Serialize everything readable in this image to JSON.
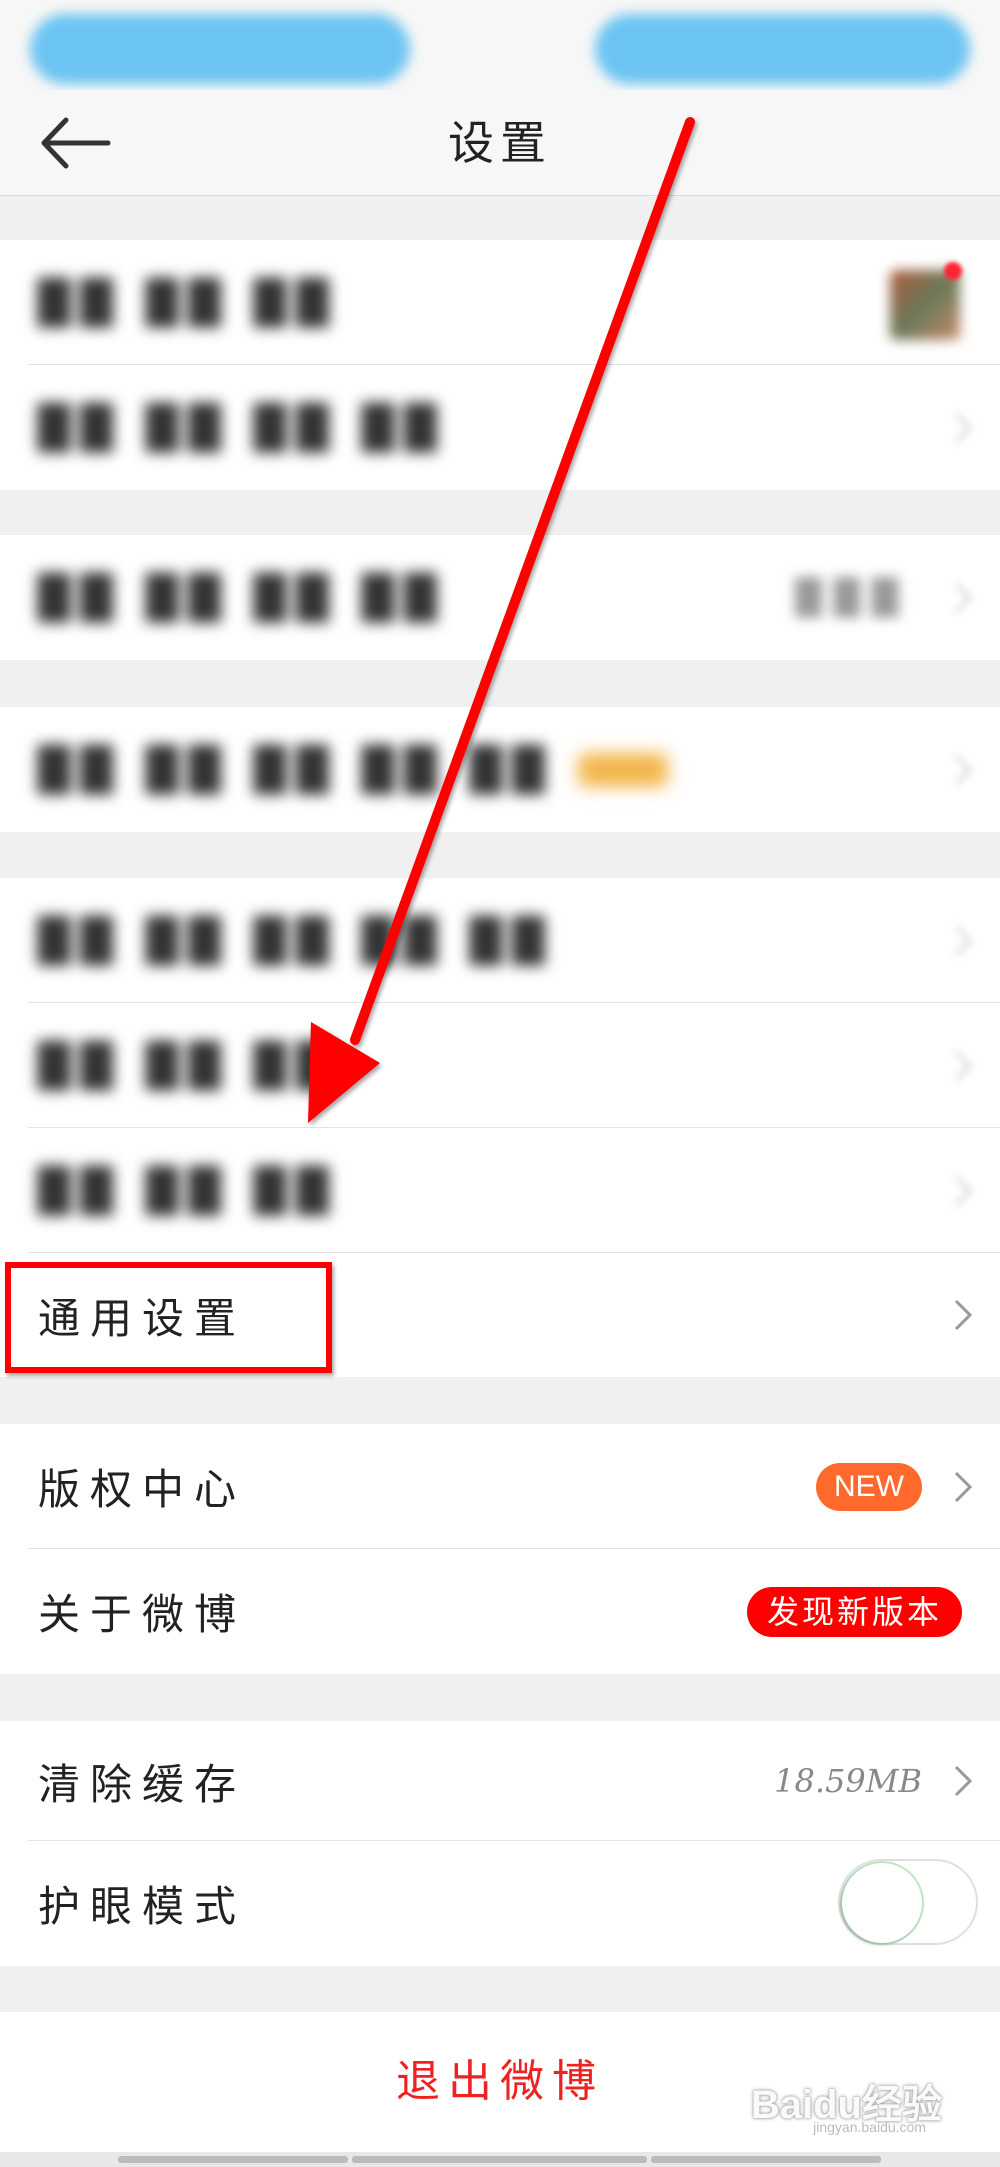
{
  "header": {
    "title": "设置"
  },
  "rows": {
    "general_settings": {
      "label": "通用设置"
    },
    "copyright_center": {
      "label": "版权中心",
      "badge": "NEW"
    },
    "about": {
      "label": "关于微博",
      "badge": "发现新版本"
    },
    "clear_cache": {
      "label": "清除缓存",
      "value": "18.59MB"
    },
    "eye_protection": {
      "label": "护眼模式",
      "toggle_on": false
    }
  },
  "logout": {
    "label": "退出微博"
  },
  "watermark": {
    "text": "Baidu经验",
    "sub": "jingyan.baidu.com"
  },
  "annotation": {
    "arrow_color": "#ff0000",
    "highlight_color": "#ff0000"
  },
  "colors": {
    "logout": "#ee2222",
    "new_badge": "#ff6a2c",
    "update_badge": "#ff0000"
  }
}
